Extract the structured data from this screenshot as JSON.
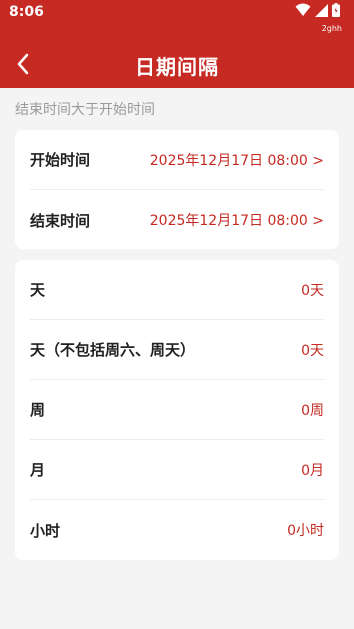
{
  "status_bar": {
    "time": "8:06",
    "carrier": "2ghh"
  },
  "app_bar": {
    "title": "日期间隔"
  },
  "hint": "结束时间大于开始时间",
  "time_rows": [
    {
      "label": "开始时间",
      "value": "2025年12月17日 08:00 >"
    },
    {
      "label": "结束时间",
      "value": "2025年12月17日 08:00 >"
    }
  ],
  "result_rows": [
    {
      "label": "天",
      "value": "0天"
    },
    {
      "label": "天（不包括周六、周天）",
      "value": "0天"
    },
    {
      "label": "周",
      "value": "0周"
    },
    {
      "label": "月",
      "value": "0月"
    },
    {
      "label": "小时",
      "value": "0小时"
    }
  ],
  "colors": {
    "accent": "#c62a22",
    "background": "#f4f4f4",
    "card": "#ffffff",
    "hint": "#9a9a9a"
  },
  "icons": [
    "wifi-icon",
    "signal-icon",
    "battery-icon",
    "back-arrow-icon"
  ]
}
